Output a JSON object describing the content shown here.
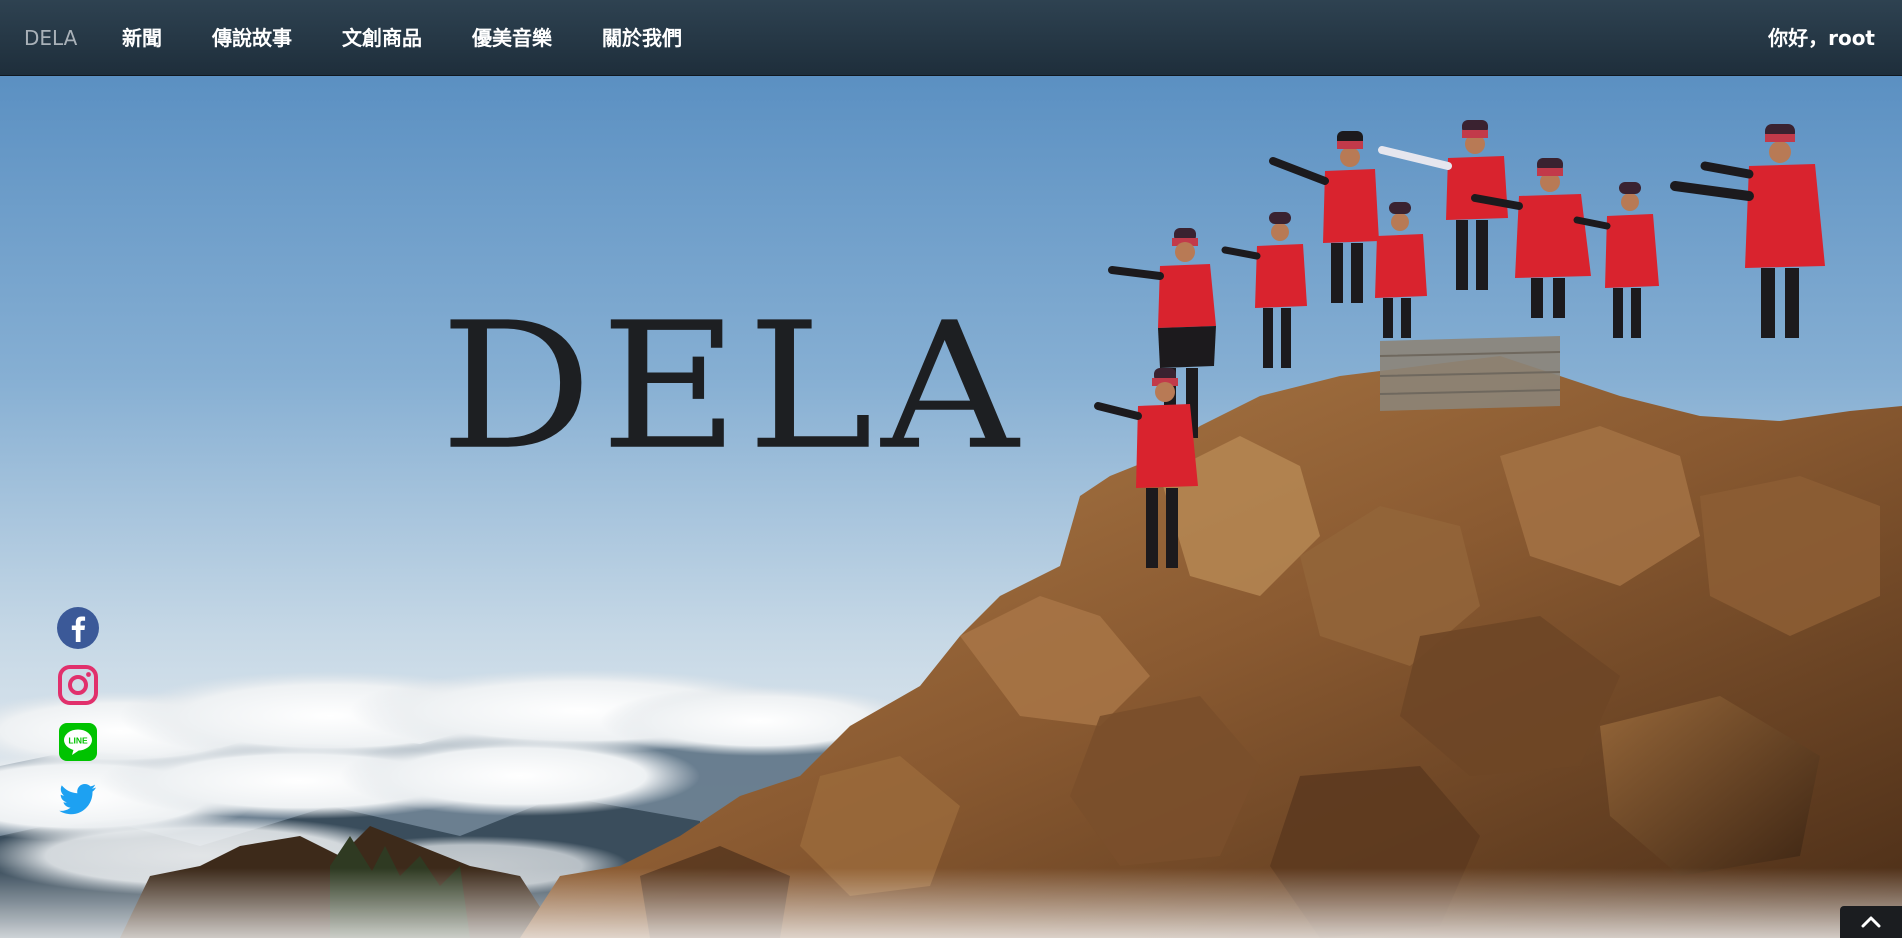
{
  "navbar": {
    "brand": "DELA",
    "links": [
      {
        "label": "新聞"
      },
      {
        "label": "傳說故事"
      },
      {
        "label": "文創商品"
      },
      {
        "label": "優美音樂"
      },
      {
        "label": "關於我們"
      }
    ],
    "greeting": "你好，root"
  },
  "hero": {
    "title": "DELA",
    "image_subject": "people in red traditional dress performing on a rocky mountain peak above a sea of clouds"
  },
  "social": [
    {
      "icon": "facebook-icon",
      "color": "#3b5998"
    },
    {
      "icon": "instagram-icon",
      "color": "#e1306c"
    },
    {
      "icon": "line-icon",
      "color": "#00c300"
    },
    {
      "icon": "twitter-icon",
      "color": "#1da1f2"
    }
  ],
  "back_to_top": {
    "icon": "chevron-up-icon"
  },
  "colors": {
    "navbar_bg": "#243644",
    "brand_text": "#a9b1b8",
    "nav_text": "#ffffff",
    "hero_title": "#1d1f22",
    "sky_top": "#5d93c4",
    "sky_bottom": "#dfe7ee",
    "costume_red": "#d9232e"
  }
}
